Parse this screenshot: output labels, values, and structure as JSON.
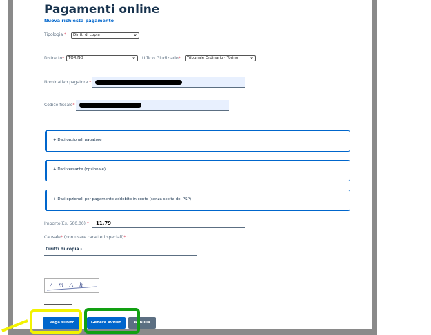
{
  "header": {
    "title": "Pagamenti online",
    "subtitle": "Nuova richiesta pagamento"
  },
  "form": {
    "tipologia": {
      "label": "Tipologia",
      "required_mark": "*",
      "value": "Diritti di copia"
    },
    "distretto": {
      "label": "Distretto",
      "required_mark": "*",
      "value": "TORINO"
    },
    "ufficio": {
      "label": "Ufficio Giudiziario",
      "required_mark": "*",
      "value": "Tribunale Ordinario - Torino"
    },
    "nominativo": {
      "label": "Nominativo pagatore",
      "required_mark": "*"
    },
    "codice_fiscale": {
      "label": "Codice fiscale",
      "required_mark": "*"
    },
    "accordions": [
      {
        "label": "+ Dati opzionali pagatore"
      },
      {
        "label": "+ Dati versante (opzionale)"
      },
      {
        "label": "+ Dati opzionali per pagamento addebito in conto (senza scelta del PSP)"
      }
    ],
    "importo": {
      "label": "Importo(Es. 500.00)",
      "required_mark": "*",
      "value": "11.79"
    },
    "causale": {
      "label": "Causale",
      "required_mark": "*",
      "label_suffix": "(non usare caratteri speciali)",
      "colon": ":",
      "value": "Diritti di copia -"
    },
    "captcha": {
      "text": "7 m A h"
    }
  },
  "actions": {
    "paga_subito": "Paga subito",
    "genera_avviso": "Genera avviso",
    "annulla": "Annulla"
  },
  "colors": {
    "primary": "#0066cc",
    "highlight_yellow": "#f2f200",
    "highlight_green": "#12a012"
  }
}
